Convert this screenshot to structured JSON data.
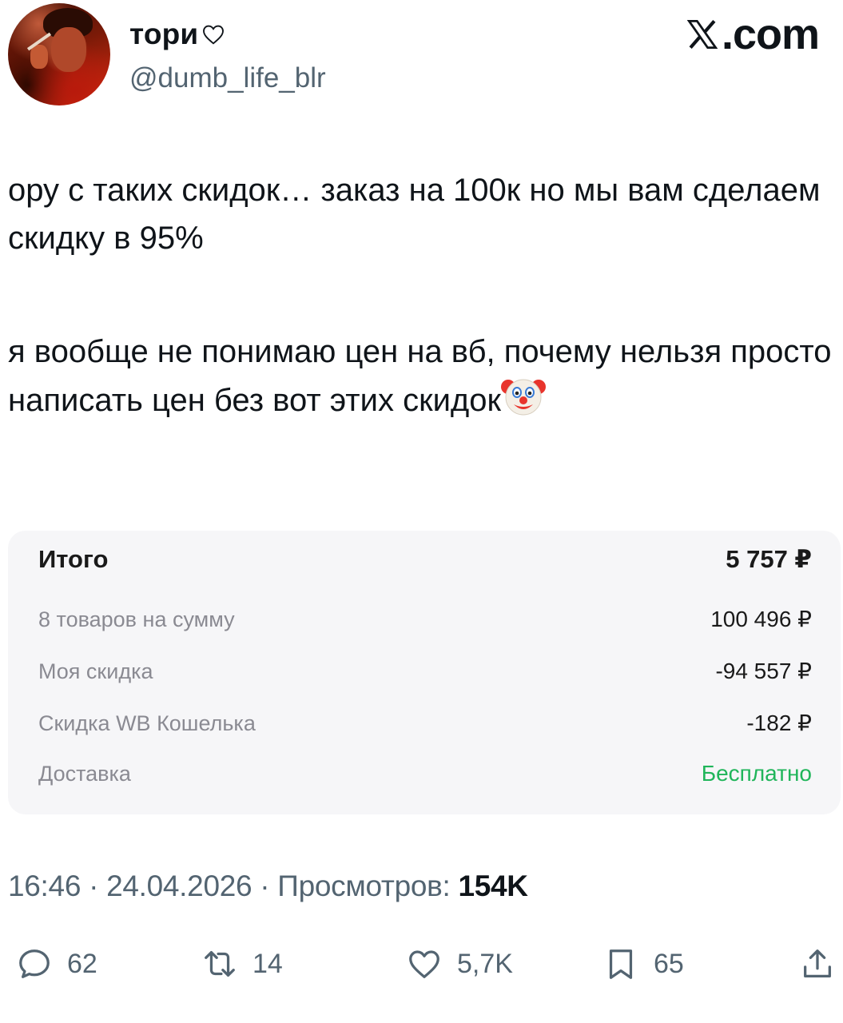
{
  "header": {
    "display_name": "тори",
    "handle": "@dumb_life_blr",
    "site": ".com",
    "icons": {
      "avatar": "profile-photo",
      "name_badge": "heart-outline-icon",
      "site_logo": "x-logo-icon"
    }
  },
  "tweet": {
    "paragraph_1": "ору с таких скидок… заказ на 100к но мы вам сделаем скидку в 95%",
    "paragraph_2": "я вообще не понимаю цен на вб, почему нельзя просто написать цен без вот этих скидок",
    "emoji": "clown-face-icon"
  },
  "receipt": {
    "total_label": "Итого",
    "total_value": "5 757 ₽",
    "rows": [
      {
        "label": "8 товаров на сумму",
        "value": "100 496 ₽"
      },
      {
        "label": "Моя скидка",
        "value": "-94 557 ₽"
      },
      {
        "label": "Скидка WB Кошелька",
        "value": "-182 ₽"
      },
      {
        "label": "Доставка",
        "value": "Бесплатно"
      }
    ],
    "colors": {
      "free_delivery": "#20b55a",
      "card_bg": "#f6f6f8"
    }
  },
  "meta": {
    "time": "16:46",
    "date": "24.04.2026",
    "views_label": "Просмотров:",
    "views_count": "154K"
  },
  "actions": {
    "replies": "62",
    "reposts": "14",
    "likes": "5,7K",
    "bookmarks": "65"
  }
}
